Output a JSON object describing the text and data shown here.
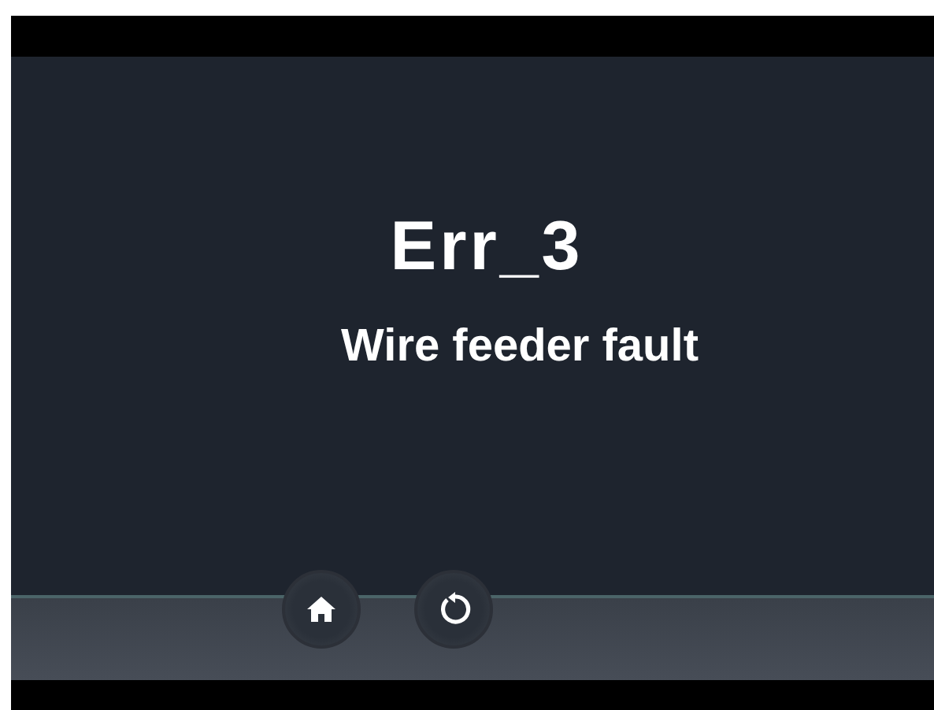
{
  "error": {
    "code": "Err_3",
    "message": "Wire feeder fault"
  },
  "buttons": [
    {
      "kind": "home"
    },
    {
      "kind": "reset"
    }
  ]
}
